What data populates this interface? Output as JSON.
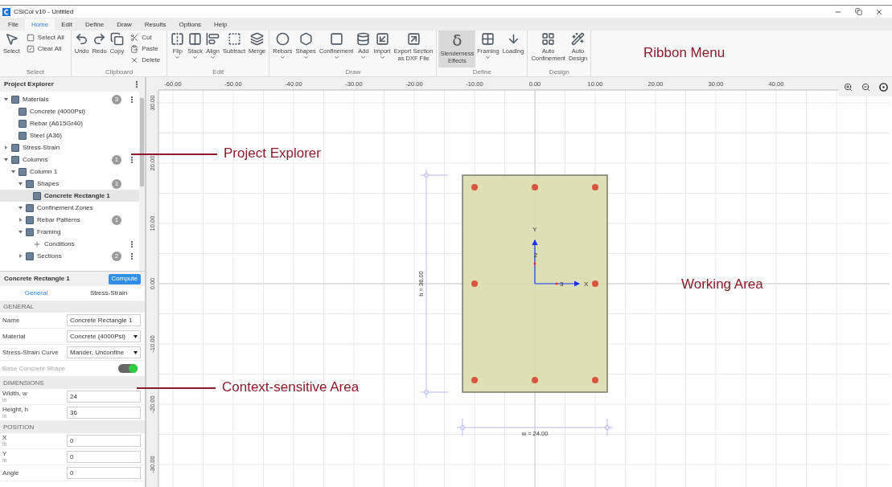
{
  "window": {
    "title": "CSiCol v10 - Untitled"
  },
  "menu_tabs": [
    {
      "label": "File",
      "selected": false
    },
    {
      "label": "Home",
      "selected": true
    },
    {
      "label": "Edit",
      "selected": false
    },
    {
      "label": "Define",
      "selected": false
    },
    {
      "label": "Draw",
      "selected": false
    },
    {
      "label": "Results",
      "selected": false
    },
    {
      "label": "Options",
      "selected": false
    },
    {
      "label": "Help",
      "selected": false
    }
  ],
  "ribbon": {
    "groups": [
      {
        "label": "Select",
        "items": [
          {
            "kind": "large",
            "label": "Select",
            "dropdown": false,
            "selected": false
          },
          {
            "kind": "small",
            "label": "Select All",
            "selected": false
          },
          {
            "kind": "small",
            "label": "Clear All",
            "selected": false
          }
        ]
      },
      {
        "label": "Clipboard",
        "items": [
          {
            "kind": "large",
            "label": "Undo",
            "dropdown": false,
            "selected": false
          },
          {
            "kind": "large",
            "label": "Redo",
            "dropdown": false,
            "selected": false
          },
          {
            "kind": "large",
            "label": "Copy",
            "dropdown": false,
            "selected": false
          },
          {
            "kind": "small",
            "label": "Cut",
            "selected": false
          },
          {
            "kind": "small",
            "label": "Paste",
            "selected": false
          },
          {
            "kind": "small",
            "label": "Delete",
            "selected": false
          }
        ]
      },
      {
        "label": "Edit",
        "items": [
          {
            "kind": "large",
            "label": "Flip",
            "dropdown": true,
            "selected": false
          },
          {
            "kind": "large",
            "label": "Stack",
            "dropdown": true,
            "selected": false
          },
          {
            "kind": "large",
            "label": "Align",
            "dropdown": true,
            "selected": false
          },
          {
            "kind": "large",
            "label": "Subtract",
            "dropdown": false,
            "selected": false
          },
          {
            "kind": "large",
            "label": "Merge",
            "dropdown": false,
            "selected": false
          }
        ]
      },
      {
        "label": "Draw",
        "items": [
          {
            "kind": "large",
            "label": "Rebars",
            "dropdown": true,
            "selected": false
          },
          {
            "kind": "large",
            "label": "Shapes",
            "dropdown": true,
            "selected": false
          },
          {
            "kind": "large",
            "label": "Confinement",
            "dropdown": true,
            "selected": false
          },
          {
            "kind": "large",
            "label": "Add",
            "dropdown": true,
            "selected": false
          },
          {
            "kind": "large",
            "label": "Import",
            "dropdown": true,
            "selected": false
          },
          {
            "kind": "large",
            "label": "Export Section\nas DXF File",
            "dropdown": false,
            "selected": false
          }
        ]
      },
      {
        "label": "Define",
        "items": [
          {
            "kind": "large",
            "label": "Slenderness\nEffects",
            "symbol": "δ",
            "dropdown": false,
            "selected": true
          },
          {
            "kind": "large",
            "label": "Framing",
            "dropdown": true,
            "selected": false
          },
          {
            "kind": "large",
            "label": "Loading",
            "dropdown": false,
            "selected": false
          }
        ]
      },
      {
        "label": "Design",
        "items": [
          {
            "kind": "large",
            "label": "Auto\nConfinement",
            "dropdown": false,
            "selected": false
          },
          {
            "kind": "large",
            "label": "Auto\nDesign",
            "dropdown": false,
            "selected": false
          }
        ]
      }
    ]
  },
  "project_explorer": {
    "title": "Project Explorer",
    "tree": [
      {
        "label": "Materials",
        "expanded": true,
        "count": "3",
        "menu": true,
        "selected": false,
        "children": [
          {
            "label": "Concrete (4000Psi)",
            "menu": false,
            "selected": false
          },
          {
            "label": "Rebar (A615Gr40)",
            "menu": false,
            "selected": false
          },
          {
            "label": "Steel (A36)",
            "menu": false,
            "selected": false
          }
        ]
      },
      {
        "label": "Stress-Strain",
        "expanded": false,
        "menu": false,
        "selected": false
      },
      {
        "label": "Columns",
        "expanded": true,
        "count": "1",
        "menu": true,
        "selected": false,
        "children": [
          {
            "label": "Column 1",
            "expanded": true,
            "menu": false,
            "selected": false,
            "children": [
              {
                "label": "Shapes",
                "expanded": true,
                "count": "1",
                "menu": false,
                "selected": false,
                "children": [
                  {
                    "label": "Concrete Rectangle 1",
                    "menu": false,
                    "selected": true
                  }
                ]
              },
              {
                "label": "Confinement Zones",
                "expanded": true,
                "menu": false,
                "selected": false
              },
              {
                "label": "Rebar Patterns",
                "expanded": false,
                "count": "1",
                "menu": false,
                "selected": false
              },
              {
                "label": "Framing",
                "expanded": true,
                "menu": false,
                "selected": false,
                "children": [
                  {
                    "label": "Conditions",
                    "menu": true,
                    "selected": false
                  }
                ]
              },
              {
                "label": "Sections",
                "expanded": false,
                "count": "2",
                "menu": true,
                "selected": false
              }
            ]
          }
        ]
      }
    ]
  },
  "properties": {
    "title": "Concrete Rectangle 1",
    "compute_button": "Compute",
    "tabs": [
      {
        "label": "General",
        "selected": true
      },
      {
        "label": "Stress-Strain",
        "selected": false
      }
    ],
    "sections": [
      {
        "title": "GENERAL",
        "rows": [
          {
            "kind": "text",
            "label": "Name",
            "value": "Concrete Rectangle 1",
            "disabled": false
          },
          {
            "kind": "select",
            "label": "Material",
            "value": "Concrete (4000Psi)",
            "disabled": false
          },
          {
            "kind": "select",
            "label": "Stress-Strain Curve",
            "value": "Mander, Unconfine",
            "disabled": false
          },
          {
            "kind": "toggle",
            "label": "Base Concrete Shape",
            "on": true,
            "disabled": true
          }
        ]
      },
      {
        "title": "DIMENSIONS",
        "rows": [
          {
            "kind": "text",
            "label": "Width, w",
            "unit": "in",
            "value": "24",
            "disabled": false
          },
          {
            "kind": "text",
            "label": "Height, h",
            "unit": "in",
            "value": "36",
            "disabled": false
          }
        ]
      },
      {
        "title": "POSITION",
        "rows": [
          {
            "kind": "text",
            "label": "X",
            "unit": "in",
            "value": "0",
            "disabled": false
          },
          {
            "kind": "text",
            "label": "Y",
            "unit": "in",
            "value": "0",
            "disabled": false
          },
          {
            "kind": "text",
            "label": "Angle",
            "value": "0",
            "disabled": false
          }
        ]
      }
    ]
  },
  "canvas": {
    "x_ruler": [
      "-60.00",
      "-50.00",
      "-40.00",
      "-30.00",
      "-20.00",
      "-10.00",
      "0.00",
      "10.00",
      "20.00",
      "30.00",
      "40.00"
    ],
    "y_ruler": [
      "30.00",
      "20.00",
      "10.00",
      "0.00",
      "-10.00",
      "-20.00",
      "-30.00"
    ],
    "height_label": "h = 36.00",
    "width_label": "w = 24.00",
    "y_axis_label": "Y",
    "y_axis_index": "2",
    "x_axis_label": "X",
    "x_axis_index": "3"
  },
  "annotations": [
    {
      "text": "Ribbon Menu",
      "leader": false
    },
    {
      "text": "Project Explorer",
      "leader": true
    },
    {
      "text": "Working Area",
      "leader": false
    },
    {
      "text": "Context-sensitive Area",
      "leader": true
    }
  ]
}
